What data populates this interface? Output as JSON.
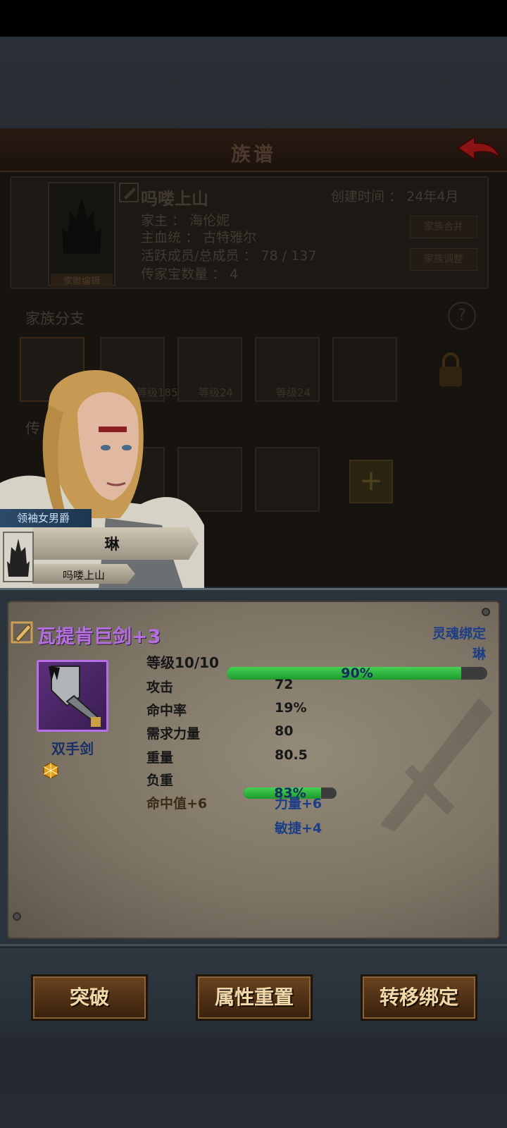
{
  "screen": {
    "title": "族谱"
  },
  "family": {
    "name": "吗喽上山",
    "created_label": "创建时间",
    "created_value": "24年4月",
    "patriarch_label": "家主",
    "patriarch_value": "海伦妮",
    "bloodline_label": "主血统",
    "bloodline_value": "古特雅尔",
    "members_label": "活跃成员/总成员",
    "members_value": "78 / 137",
    "heirlooms_label": "传家宝数量",
    "heirlooms_value": "4",
    "emblem_label": "家徽编辑",
    "merge_button": "家族合并",
    "adjust_button": "家族调整",
    "branch_title": "家族分支",
    "branch_levels": [
      "等级185",
      "等级24",
      "等级24"
    ],
    "heirloom_title": "传"
  },
  "character": {
    "title": "领袖女男爵",
    "name": "琳",
    "house": "吗喽上山"
  },
  "item": {
    "name": "瓦提肯巨剑+3",
    "bind_status": "灵魂绑定",
    "bound_to": "琳",
    "type": "双手剑",
    "rarity_color": "#b56fe0",
    "level_label": "等级10/10",
    "level_progress_text": "90%",
    "level_progress": 0.9,
    "stats": [
      {
        "label": "攻击",
        "value": "72"
      },
      {
        "label": "命中率",
        "value": "19%"
      },
      {
        "label": "需求力量",
        "value": "80"
      },
      {
        "label": "重量",
        "value": "80.5"
      }
    ],
    "load_label": "负重",
    "load_text": "83%",
    "load_progress": 0.83,
    "bonuses": {
      "hit": "命中值+6",
      "strength": "力量+6",
      "agility": "敏捷+4"
    }
  },
  "actions": {
    "breakthrough": "突破",
    "reset_attributes": "属性重置",
    "transfer_binding": "转移绑定"
  },
  "icons": [
    "back-arrow-icon",
    "edit-pen-icon",
    "help-icon",
    "lock-icon",
    "add-icon",
    "gem-icon",
    "sword-icon",
    "family-crest-icon"
  ]
}
